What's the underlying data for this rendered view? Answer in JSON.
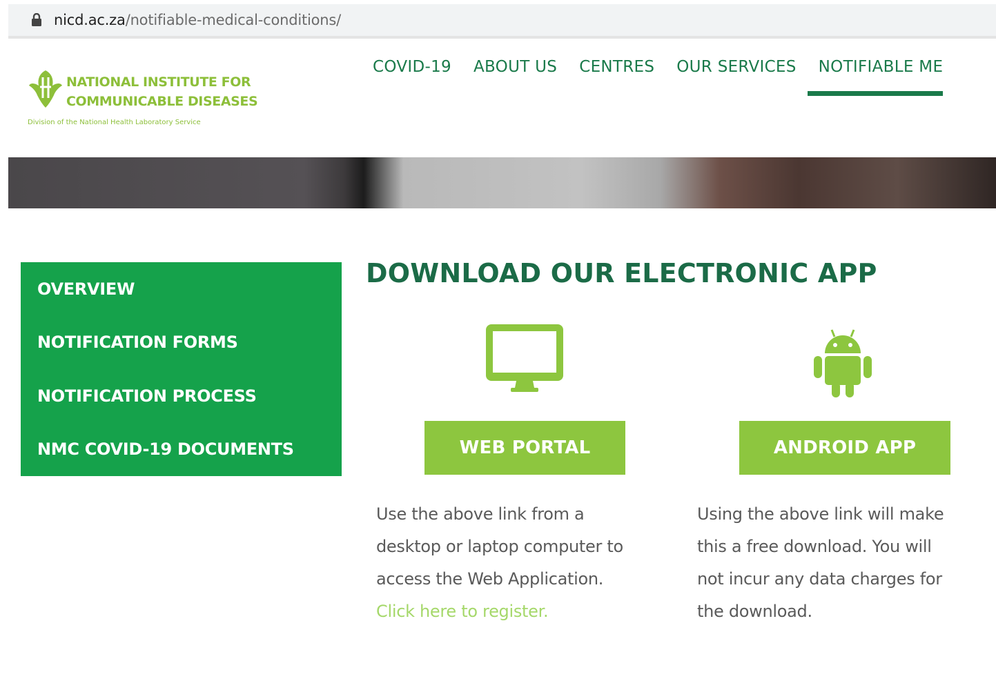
{
  "browser": {
    "url_domain": "nicd.ac.za",
    "url_path": "/notifiable-medical-conditions/"
  },
  "header": {
    "logo": {
      "line1": "NATIONAL INSTITUTE FOR",
      "line2": "COMMUNICABLE DISEASES",
      "tagline": "Division of the National Health Laboratory Service"
    },
    "nav": [
      {
        "label": "COVID-19"
      },
      {
        "label": "ABOUT US"
      },
      {
        "label": "CENTRES"
      },
      {
        "label": "OUR SERVICES"
      },
      {
        "label": "NOTIFIABLE ME"
      }
    ]
  },
  "sidebar": {
    "items": [
      {
        "label": "OVERVIEW"
      },
      {
        "label": "NOTIFICATION FORMS"
      },
      {
        "label": "NOTIFICATION PROCESS"
      },
      {
        "label": "NMC COVID-19 DOCUMENTS"
      }
    ]
  },
  "main": {
    "title": "DOWNLOAD OUR ELECTRONIC APP",
    "web": {
      "icon": "desktop-icon",
      "button": "WEB PORTAL",
      "lines": [
        "Use the above link from a",
        "desktop or laptop computer to",
        "access the Web Application."
      ],
      "link": "Click here to register."
    },
    "android": {
      "icon": "android-icon",
      "button": "ANDROID APP",
      "lines": [
        "Using the above link will make",
        "this a free download. You will",
        "not incur any data charges for",
        "the download."
      ]
    }
  },
  "colors": {
    "sidebar_bg": "#15a24b",
    "button_bg": "#8dc63f",
    "heading": "#1b6b47",
    "nav": "#1a7a4a",
    "link": "#a5d86a"
  }
}
